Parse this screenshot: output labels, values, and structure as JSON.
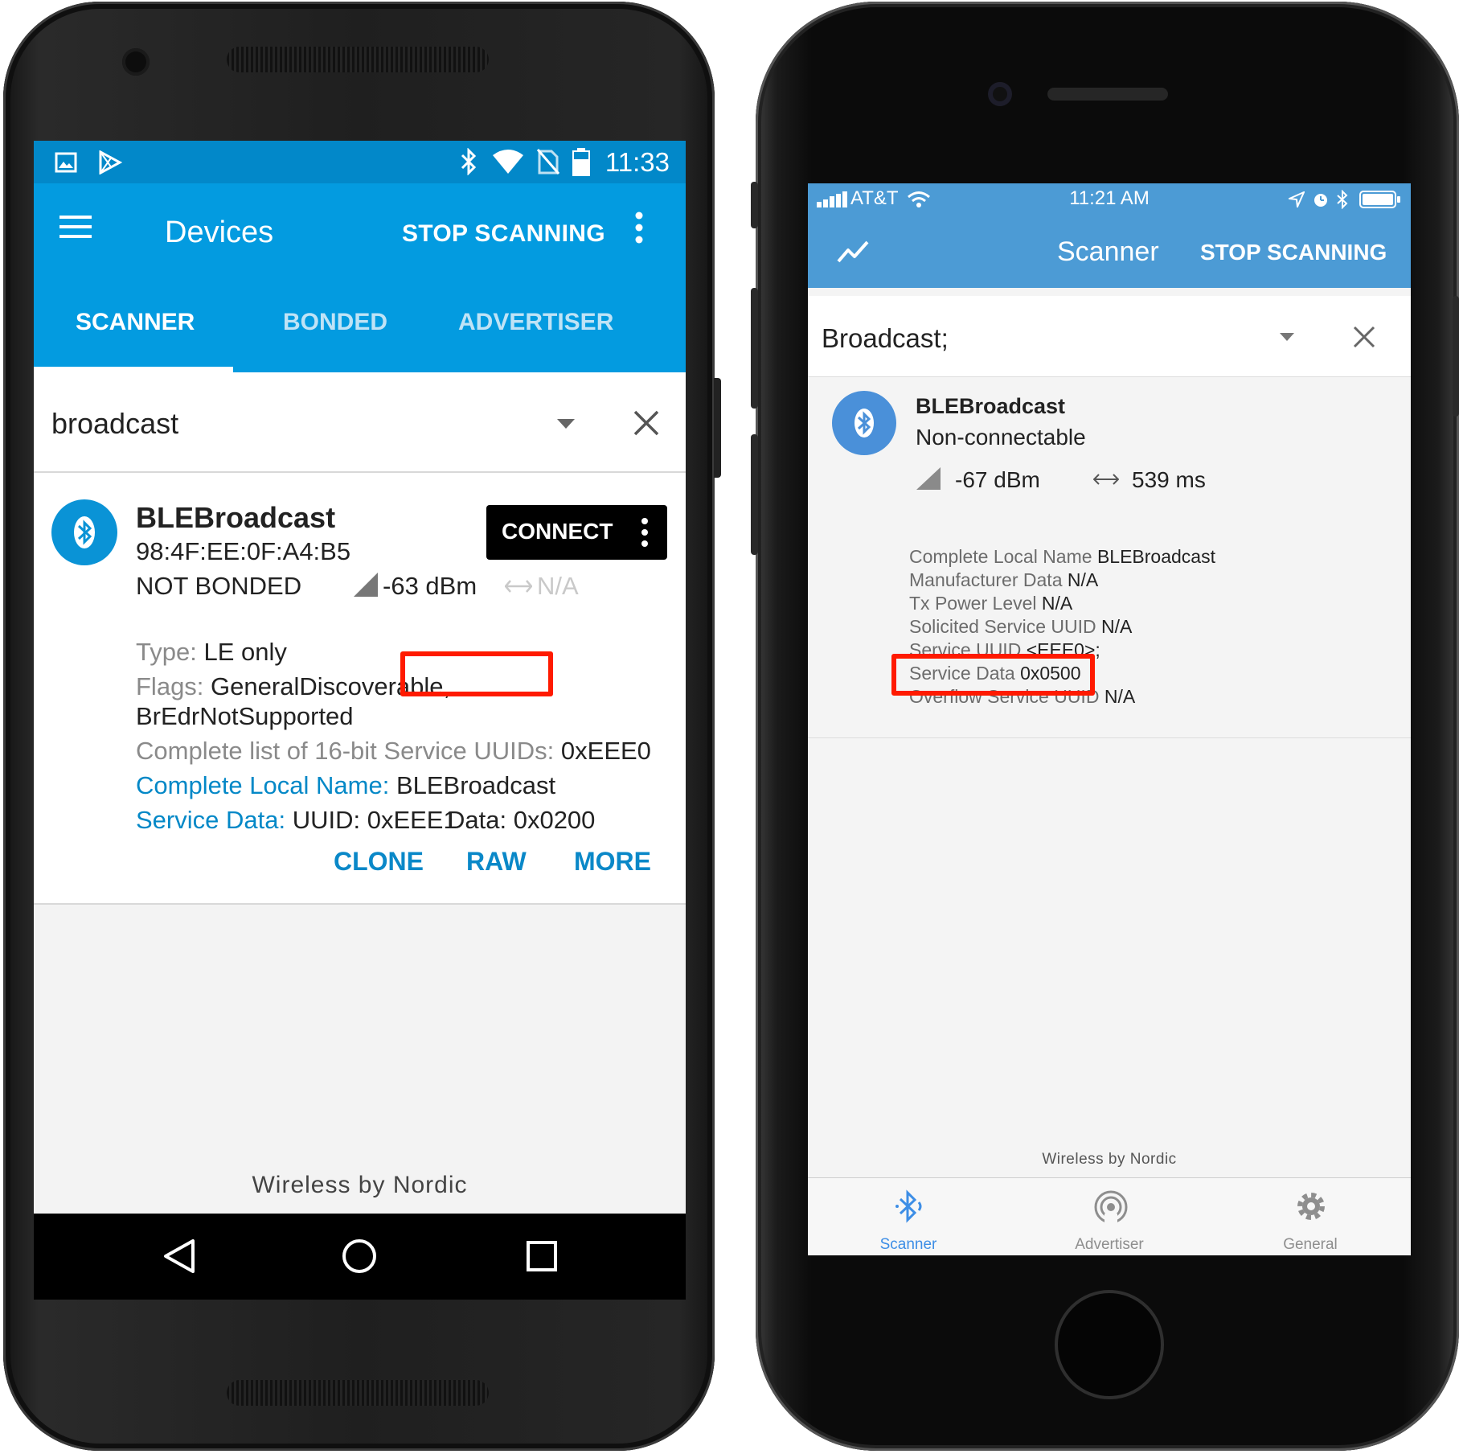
{
  "android": {
    "status_bar": {
      "time": "11:33",
      "left_icons": [
        "image-icon",
        "play-store-icon"
      ],
      "right_icons": [
        "bluetooth-icon",
        "wifi-icon",
        "no-sim-icon",
        "battery-icon"
      ]
    },
    "toolbar": {
      "title": "Devices",
      "stop_scanning_label": "STOP SCANNING",
      "menu_icon": "hamburger-icon",
      "overflow_icon": "more-vert-icon"
    },
    "tabs": [
      {
        "label": "SCANNER",
        "active": true
      },
      {
        "label": "BONDED",
        "active": false
      },
      {
        "label": "ADVERTISER",
        "active": false
      }
    ],
    "filter": {
      "text": "broadcast"
    },
    "device": {
      "name": "BLEBroadcast",
      "address": "98:4F:EE:0F:A4:B5",
      "bond_state": "NOT BONDED",
      "rssi": "-63 dBm",
      "interval": "N/A",
      "connect_label": "CONNECT",
      "details": {
        "type_key": "Type:",
        "type_value": "LE only",
        "flags_key": "Flags:",
        "flags_value_1": "GeneralDiscoverable,",
        "flags_value_2": "BrEdrNotSupported",
        "uuids_key": "Complete list of 16-bit Service UUIDs:",
        "uuids_value": "0xEEE0",
        "local_name_key": "Complete Local Name:",
        "local_name_value": "BLEBroadcast",
        "service_data_key": "Service Data:",
        "service_data_value": "UUID: 0xEEE1",
        "service_data_highlight": "Data: 0x0200"
      },
      "actions": [
        "CLONE",
        "RAW",
        "MORE"
      ]
    },
    "footer": "Wireless by Nordic",
    "nav_icons": [
      "back-icon",
      "home-icon",
      "recents-icon"
    ],
    "colors": {
      "toolbar": "#039be0",
      "status": "#0288c9",
      "accent": "#0a88c8",
      "highlight": "#ff1a00"
    }
  },
  "ios": {
    "status_bar": {
      "carrier": "AT&T",
      "time": "11:21 AM",
      "right_icons": [
        "location-icon",
        "alarm-icon",
        "bluetooth-icon",
        "battery-icon"
      ]
    },
    "navbar": {
      "title": "Scanner",
      "stop_scanning_label": "STOP SCANNING",
      "left_icon": "graph-icon"
    },
    "filter": {
      "text": "Broadcast;"
    },
    "device": {
      "name": "BLEBroadcast",
      "connectable": "Non-connectable",
      "rssi": "-67 dBm",
      "interval": "539 ms",
      "advertisement": [
        {
          "key": "Complete Local Name",
          "value": "BLEBroadcast"
        },
        {
          "key": "Manufacturer Data",
          "value": "N/A"
        },
        {
          "key": "Tx Power Level",
          "value": "N/A"
        },
        {
          "key": "Solicited Service UUID",
          "value": "N/A"
        },
        {
          "key": "Service UUID",
          "value": "<EEE0>;"
        },
        {
          "key": "Service Data",
          "value": "0x0500"
        },
        {
          "key": "Overflow Service UUID",
          "value": "N/A"
        }
      ]
    },
    "footer": "Wireless by Nordic",
    "tabbar": [
      {
        "label": "Scanner",
        "icon": "bluetooth-scan-icon",
        "active": true
      },
      {
        "label": "Advertiser",
        "icon": "broadcast-icon",
        "active": false
      },
      {
        "label": "General",
        "icon": "gear-icon",
        "active": false
      }
    ],
    "colors": {
      "navbar": "#4c9bd5",
      "tint": "#3d8ee6",
      "highlight": "#ff1a00"
    }
  }
}
